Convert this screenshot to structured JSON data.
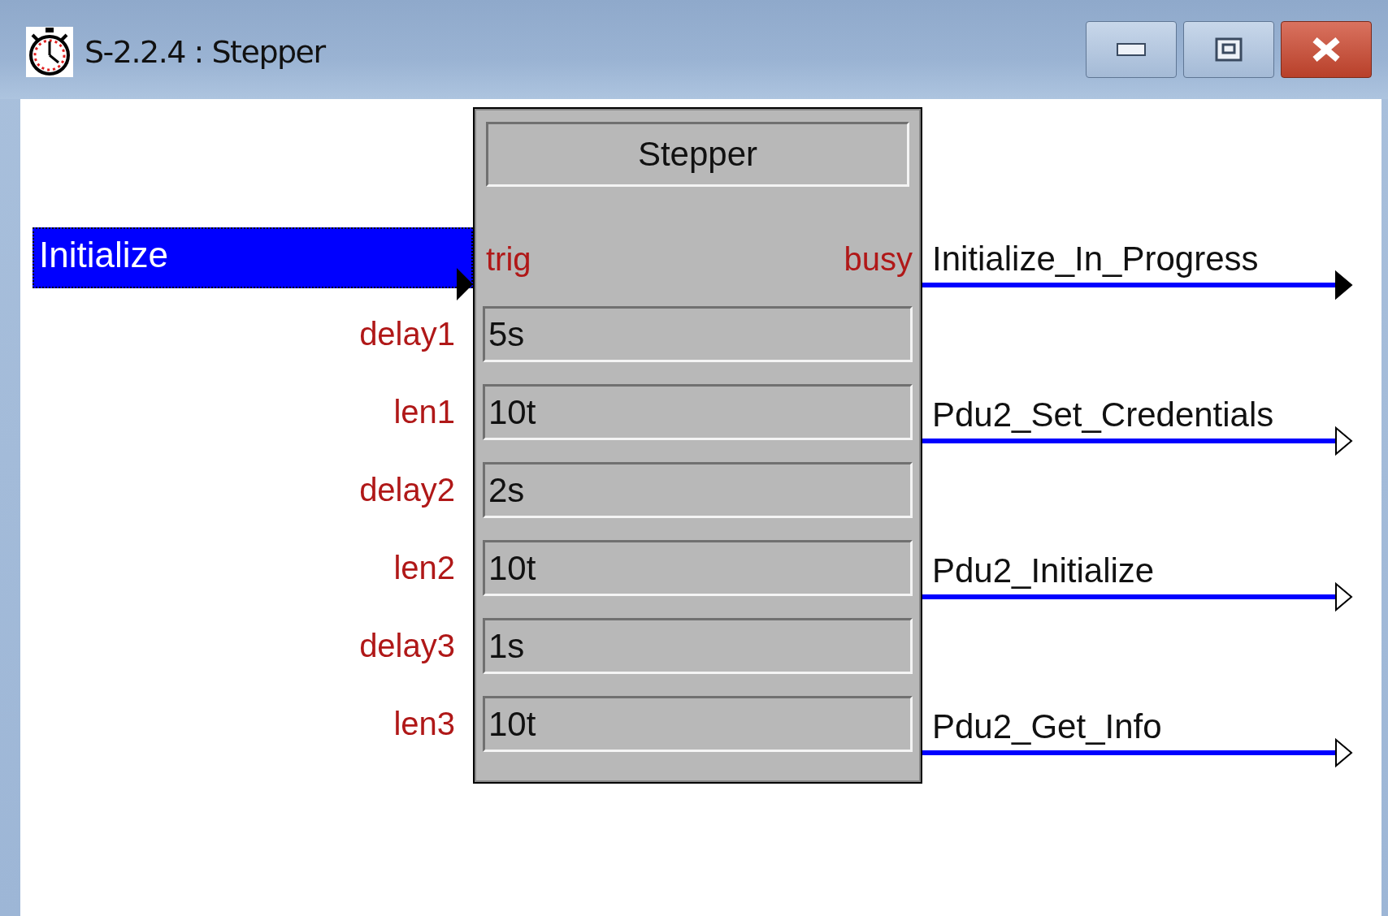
{
  "window": {
    "title": "S-2.2.4 : Stepper"
  },
  "block": {
    "title": "Stepper",
    "trigger_port": "trig",
    "busy_port": "busy",
    "parameters": [
      {
        "name": "delay1",
        "value": "5s"
      },
      {
        "name": "len1",
        "value": "10t"
      },
      {
        "name": "delay2",
        "value": "2s"
      },
      {
        "name": "len2",
        "value": "10t"
      },
      {
        "name": "delay3",
        "value": "1s"
      },
      {
        "name": "len3",
        "value": "10t"
      }
    ]
  },
  "input": {
    "label": "Initialize",
    "selected": true
  },
  "outputs": [
    {
      "label": "Initialize_In_Progress",
      "active": true
    },
    {
      "label": "Pdu2_Set_Credentials",
      "active": false
    },
    {
      "label": "Pdu2_Initialize",
      "active": false
    },
    {
      "label": "Pdu2_Get_Info",
      "active": false
    }
  ]
}
